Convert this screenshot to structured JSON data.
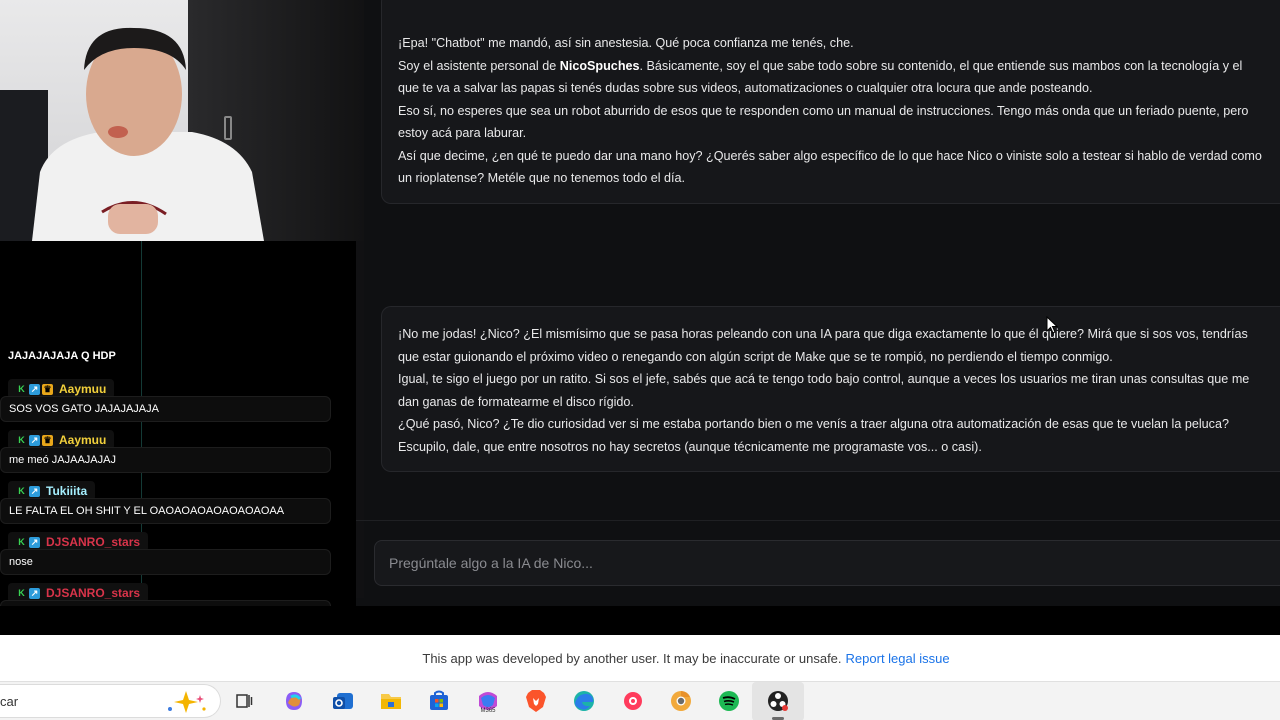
{
  "chat_feed": {
    "top_message": "JAJAJAJAJA Q HDP",
    "entries": [
      {
        "user": "Aaymuu",
        "user_color": "#f2d03b",
        "badges": [
          "moderator-icon",
          "prime-icon",
          "sub-icon"
        ],
        "message": "SOS VOS GATO JAJAJAJAJA"
      },
      {
        "user": "Aaymuu",
        "user_color": "#f2d03b",
        "badges": [
          "moderator-icon",
          "prime-icon",
          "sub-icon"
        ],
        "message": "me meó JAJAAJAJAJ"
      },
      {
        "user": "Tukiiita",
        "user_color": "#a6f0ff",
        "badges": [
          "moderator-icon",
          "prime-icon"
        ],
        "message": "LE FALTA EL OH SHIT Y EL OAOAOAOAOAOAOAOAA"
      },
      {
        "user": "DJSANRO_stars",
        "user_color": "#d9344a",
        "badges": [
          "moderator-icon",
          "prime-icon"
        ],
        "message": "nose"
      },
      {
        "user": "DJSANRO_stars",
        "user_color": "#d9344a",
        "badges": [
          "moderator-icon",
          "prime-icon"
        ],
        "message": ""
      }
    ]
  },
  "conversation": {
    "message_1": {
      "l1": "¡Epa! \"Chatbot\" me mandó, así sin anestesia. Qué poca confianza me tenés, che.",
      "l2_pre": "Soy el asistente personal de ",
      "l2_bold": "NicoSpuches",
      "l2_post": ". Básicamente, soy el que sabe todo sobre su contenido, el que entiende sus mambos con la tecnología y el que te va a salvar las papas si tenés dudas sobre sus videos, automatizaciones o cualquier otra locura que ande posteando.",
      "l3": "Eso sí, no esperes que sea un robot aburrido de esos que te responden como un manual de instrucciones. Tengo más onda que un feriado puente, pero estoy acá para laburar.",
      "l4": "Así que decime, ¿en qué te puedo dar una mano hoy? ¿Querés saber algo específico de lo que hace Nico o viniste solo a testear si hablo de verdad como un rioplatense? Metéle que no tenemos todo el día."
    },
    "message_2": {
      "l1": "¡No me jodas! ¿Nico? ¿El mismísimo que se pasa horas peleando con una IA para que diga exactamente lo que él quiere? Mirá que si sos vos, tendrías que estar guionando el próximo video o renegando con algún script de Make que se te rompió, no perdiendo el tiempo conmigo.",
      "l2": "Igual, te sigo el juego por un ratito. Si sos el jefe, sabés que acá te tengo todo bajo control, aunque a veces los usuarios me tiran unas consultas que me dan ganas de formatearme el disco rígido.",
      "l3": "¿Qué pasó, Nico? ¿Te dio curiosidad ver si me estaba portando bien o me venís a traer alguna otra automatización de esas que te vuelan la peluca? Escupilo, dale, que entre nosotros no hay secretos (aunque técnicamente me programaste vos... o casi)."
    }
  },
  "composer": {
    "placeholder": "Pregúntale algo a la IA de Nico..."
  },
  "notice": {
    "text": "This app was developed by another user. It may be inaccurate or unsafe.",
    "link": "Report legal issue"
  },
  "taskbar": {
    "search_label": "car",
    "icons": [
      "task-view-icon",
      "copilot-app-icon",
      "outlook-icon",
      "file-explorer-icon",
      "microsoft-store-icon",
      "microsoft-365-icon",
      "brave-icon",
      "edge-icon",
      "app-icon",
      "chrome-canary-icon",
      "spotify-icon",
      "obs-icon"
    ]
  }
}
